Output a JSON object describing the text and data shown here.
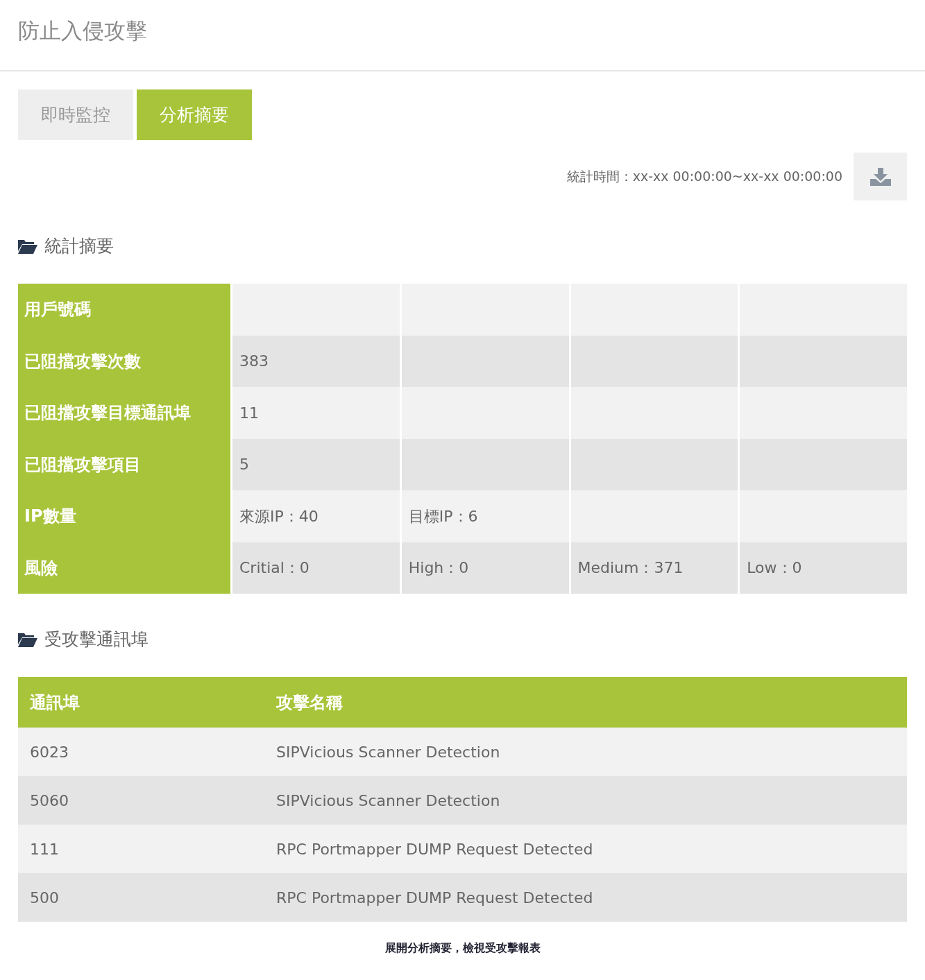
{
  "page_title": "防止入侵攻擊",
  "tabs": [
    {
      "label": "即時監控",
      "selected": false
    },
    {
      "label": "分析摘要",
      "selected": true
    }
  ],
  "period": {
    "label": "統計時間：",
    "value": "xx-xx 00:00:00~xx-xx 00:00:00"
  },
  "summary": {
    "heading": "統計摘要",
    "rows": [
      {
        "label": "用戶號碼",
        "values": []
      },
      {
        "label": "已阻擋攻擊次數",
        "values": [
          "383"
        ]
      },
      {
        "label": "已阻擋攻擊目標通訊埠",
        "values": [
          "11"
        ]
      },
      {
        "label": "已阻擋攻擊項目",
        "values": [
          "5"
        ]
      },
      {
        "label": "IP數量",
        "values": [
          "來源IP：40",
          "目標IP：6"
        ]
      },
      {
        "label": "風險",
        "values": [
          "Critial：0",
          "High：0",
          "Medium：371",
          "Low：0"
        ]
      }
    ]
  },
  "ports": {
    "heading": "受攻擊通訊埠",
    "columns": [
      "通訊埠",
      "攻擊名稱"
    ],
    "rows": [
      [
        "6023",
        "SIPVicious Scanner Detection"
      ],
      [
        "5060",
        "SIPVicious Scanner Detection"
      ],
      [
        "111",
        "RPC Portmapper DUMP Request Detected"
      ],
      [
        "500",
        "RPC Portmapper DUMP Request Detected"
      ]
    ]
  },
  "footer_note": "展開分析摘要，檢視受攻擊報表"
}
